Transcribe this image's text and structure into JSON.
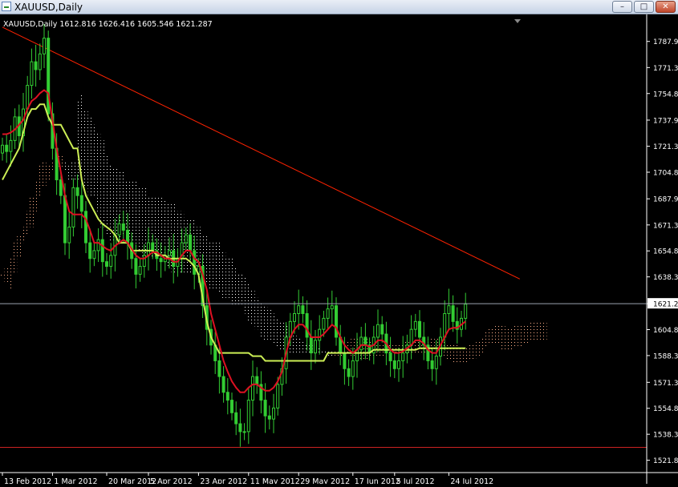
{
  "window": {
    "title": "XAUUSD,Daily",
    "buttons": {
      "minimize": "–",
      "maximize": "□",
      "close": "✕"
    }
  },
  "chart_info": "XAUUSD,Daily  1612.816 1626.416 1605.546 1621.287",
  "price_marker": "1621.28",
  "colors": {
    "background": "#000000",
    "candles": "#33cc33",
    "tenkan": "#dd1122",
    "kijun": "#ccee55",
    "trendline": "#ff2200",
    "support": "#cc2222",
    "cloud_a": "#ffb089",
    "cloud_b": "#ffffff"
  },
  "chart_data": {
    "type": "line",
    "ylim": [
      1515,
      1800
    ],
    "y_ticks": [
      "1787.93",
      "1771.33",
      "1754.83",
      "1737.93",
      "1721.33",
      "1704.83",
      "1687.93",
      "1671.33",
      "1654.83",
      "1638.33",
      "1621.28",
      "1604.83",
      "1588.33",
      "1571.33",
      "1554.83",
      "1538.33",
      "1521.83"
    ],
    "x_ticks": [
      "13 Feb 2012",
      "1 Mar 2012",
      "20 Mar 2012",
      "5 Apr 2012",
      "23 Apr 2012",
      "11 May 2012",
      "29 May 2012",
      "17 Jun 2012",
      "5 Jul 2012",
      "24 Jul 2012"
    ],
    "current_price": 1621.28,
    "support_level": 1530,
    "trendline": {
      "start": [
        0,
        1797
      ],
      "end": [
        124,
        1637
      ]
    },
    "x_tick_index": [
      0,
      12,
      25,
      35,
      47,
      59,
      71,
      84,
      94,
      107
    ],
    "closes": [
      1722,
      1718,
      1725,
      1740,
      1728,
      1745,
      1760,
      1775,
      1770,
      1780,
      1790,
      1742,
      1720,
      1700,
      1690,
      1660,
      1670,
      1695,
      1690,
      1680,
      1660,
      1650,
      1655,
      1662,
      1648,
      1645,
      1652,
      1665,
      1672,
      1668,
      1660,
      1650,
      1640,
      1645,
      1652,
      1660,
      1655,
      1650,
      1648,
      1652,
      1655,
      1645,
      1650,
      1660,
      1665,
      1655,
      1640,
      1645,
      1620,
      1605,
      1595,
      1585,
      1575,
      1565,
      1560,
      1552,
      1545,
      1540,
      1540,
      1560,
      1575,
      1570,
      1560,
      1550,
      1548,
      1555,
      1570,
      1580,
      1600,
      1610,
      1615,
      1620,
      1615,
      1600,
      1590,
      1598,
      1605,
      1612,
      1618,
      1620,
      1600,
      1590,
      1580,
      1575,
      1585,
      1592,
      1600,
      1595,
      1590,
      1600,
      1608,
      1602,
      1590,
      1585,
      1580,
      1585,
      1590,
      1595,
      1605,
      1610,
      1600,
      1595,
      1585,
      1580,
      1588,
      1600,
      1615,
      1620,
      1610,
      1605,
      1612,
      1621
    ],
    "tenkan": [
      1729,
      1729,
      1730,
      1732,
      1735,
      1738,
      1745,
      1750,
      1752,
      1755,
      1757,
      1755,
      1738,
      1720,
      1705,
      1690,
      1680,
      1678,
      1678,
      1678,
      1675,
      1668,
      1660,
      1660,
      1658,
      1656,
      1655,
      1658,
      1660,
      1662,
      1660,
      1656,
      1652,
      1650,
      1650,
      1652,
      1654,
      1654,
      1652,
      1650,
      1650,
      1648,
      1648,
      1652,
      1655,
      1655,
      1650,
      1648,
      1640,
      1630,
      1615,
      1605,
      1595,
      1585,
      1578,
      1572,
      1568,
      1565,
      1565,
      1568,
      1570,
      1570,
      1568,
      1566,
      1566,
      1568,
      1572,
      1578,
      1590,
      1600,
      1605,
      1608,
      1608,
      1605,
      1600,
      1600,
      1600,
      1602,
      1605,
      1608,
      1606,
      1600,
      1595,
      1592,
      1590,
      1592,
      1595,
      1595,
      1594,
      1595,
      1598,
      1598,
      1596,
      1592,
      1590,
      1590,
      1591,
      1593,
      1595,
      1598,
      1598,
      1596,
      1592,
      1590,
      1590,
      1595,
      1600,
      1605,
      1606,
      1606,
      1608,
      1610
    ],
    "kijun": [
      1700,
      1705,
      1710,
      1715,
      1720,
      1730,
      1740,
      1745,
      1745,
      1748,
      1748,
      1740,
      1735,
      1735,
      1735,
      1730,
      1725,
      1720,
      1720,
      1700,
      1690,
      1685,
      1680,
      1675,
      1672,
      1670,
      1668,
      1665,
      1660,
      1660,
      1660,
      1655,
      1655,
      1655,
      1655,
      1655,
      1655,
      1652,
      1652,
      1652,
      1650,
      1650,
      1650,
      1650,
      1650,
      1648,
      1645,
      1640,
      1625,
      1610,
      1600,
      1595,
      1590,
      1590,
      1590,
      1590,
      1590,
      1590,
      1590,
      1590,
      1588,
      1588,
      1588,
      1585,
      1585,
      1585,
      1585,
      1585,
      1585,
      1585,
      1585,
      1585,
      1585,
      1585,
      1585,
      1585,
      1585,
      1585,
      1590,
      1590,
      1590,
      1590,
      1590,
      1590,
      1590,
      1590,
      1590,
      1590,
      1590,
      1592,
      1592,
      1592,
      1592,
      1592,
      1592,
      1592,
      1592,
      1592,
      1592,
      1592,
      1593,
      1593,
      1593,
      1593,
      1593,
      1593,
      1593,
      1593,
      1593,
      1593,
      1593,
      1593
    ],
    "cloud": [
      [
        1640,
        1640
      ],
      [
        1635,
        1645
      ],
      [
        1630,
        1650
      ],
      [
        1640,
        1660
      ],
      [
        1650,
        1665
      ],
      [
        1660,
        1670
      ],
      [
        1665,
        1680
      ],
      [
        1670,
        1690
      ],
      [
        1680,
        1700
      ],
      [
        1690,
        1710
      ],
      [
        1695,
        1712
      ],
      [
        1700,
        1710
      ],
      [
        1705,
        1712
      ],
      [
        1708,
        1712
      ],
      [
        1708,
        1715
      ],
      [
        1705,
        1712
      ],
      [
        1700,
        1710
      ],
      [
        1700,
        1712
      ],
      [
        1700,
        1750
      ],
      [
        1700,
        1755
      ],
      [
        1695,
        1745
      ],
      [
        1690,
        1740
      ],
      [
        1690,
        1735
      ],
      [
        1680,
        1730
      ],
      [
        1670,
        1725
      ],
      [
        1665,
        1715
      ],
      [
        1660,
        1710
      ],
      [
        1660,
        1708
      ],
      [
        1660,
        1705
      ],
      [
        1665,
        1705
      ],
      [
        1665,
        1700
      ],
      [
        1660,
        1700
      ],
      [
        1655,
        1700
      ],
      [
        1655,
        1695
      ],
      [
        1650,
        1695
      ],
      [
        1650,
        1690
      ],
      [
        1650,
        1690
      ],
      [
        1650,
        1690
      ],
      [
        1650,
        1690
      ],
      [
        1648,
        1688
      ],
      [
        1645,
        1685
      ],
      [
        1640,
        1685
      ],
      [
        1640,
        1680
      ],
      [
        1640,
        1680
      ],
      [
        1640,
        1675
      ],
      [
        1640,
        1675
      ],
      [
        1640,
        1675
      ],
      [
        1640,
        1670
      ],
      [
        1640,
        1665
      ],
      [
        1635,
        1665
      ],
      [
        1630,
        1660
      ],
      [
        1630,
        1660
      ],
      [
        1628,
        1660
      ],
      [
        1625,
        1655
      ],
      [
        1625,
        1650
      ],
      [
        1620,
        1650
      ],
      [
        1620,
        1645
      ],
      [
        1620,
        1640
      ],
      [
        1615,
        1638
      ],
      [
        1610,
        1635
      ],
      [
        1608,
        1630
      ],
      [
        1605,
        1625
      ],
      [
        1600,
        1622
      ],
      [
        1598,
        1620
      ],
      [
        1598,
        1618
      ],
      [
        1596,
        1615
      ],
      [
        1594,
        1612
      ],
      [
        1592,
        1610
      ],
      [
        1590,
        1608
      ],
      [
        1590,
        1605
      ],
      [
        1590,
        1602
      ],
      [
        1590,
        1600
      ],
      [
        1590,
        1598
      ],
      [
        1590,
        1596
      ],
      [
        1590,
        1595
      ],
      [
        1590,
        1594
      ],
      [
        1590,
        1593
      ],
      [
        1590,
        1592
      ],
      [
        1588,
        1592
      ],
      [
        1588,
        1592
      ],
      [
        1588,
        1592
      ],
      [
        1588,
        1592
      ],
      [
        1590,
        1595
      ],
      [
        1590,
        1598
      ],
      [
        1588,
        1600
      ],
      [
        1588,
        1600
      ],
      [
        1586,
        1600
      ],
      [
        1586,
        1600
      ],
      [
        1588,
        1598
      ],
      [
        1588,
        1596
      ],
      [
        1588,
        1596
      ],
      [
        1588,
        1596
      ],
      [
        1590,
        1596
      ],
      [
        1590,
        1596
      ],
      [
        1590,
        1596
      ],
      [
        1590,
        1596
      ],
      [
        1590,
        1596
      ],
      [
        1590,
        1598
      ],
      [
        1590,
        1598
      ],
      [
        1590,
        1598
      ],
      [
        1590,
        1598
      ],
      [
        1590,
        1600
      ],
      [
        1592,
        1600
      ],
      [
        1592,
        1600
      ],
      [
        1592,
        1600
      ],
      [
        1592,
        1600
      ],
      [
        1588,
        1598
      ],
      [
        1585,
        1596
      ],
      [
        1584,
        1595
      ],
      [
        1584,
        1595
      ],
      [
        1584,
        1594
      ],
      [
        1584,
        1594
      ],
      [
        1585,
        1596
      ],
      [
        1586,
        1596
      ],
      [
        1588,
        1598
      ],
      [
        1590,
        1600
      ],
      [
        1594,
        1604
      ],
      [
        1596,
        1606
      ],
      [
        1596,
        1608
      ],
      [
        1596,
        1608
      ],
      [
        1592,
        1608
      ],
      [
        1592,
        1606
      ],
      [
        1592,
        1606
      ],
      [
        1594,
        1608
      ],
      [
        1594,
        1608
      ],
      [
        1596,
        1608
      ],
      [
        1596,
        1608
      ],
      [
        1598,
        1610
      ],
      [
        1598,
        1610
      ],
      [
        1598,
        1610
      ],
      [
        1598,
        1610
      ]
    ]
  }
}
